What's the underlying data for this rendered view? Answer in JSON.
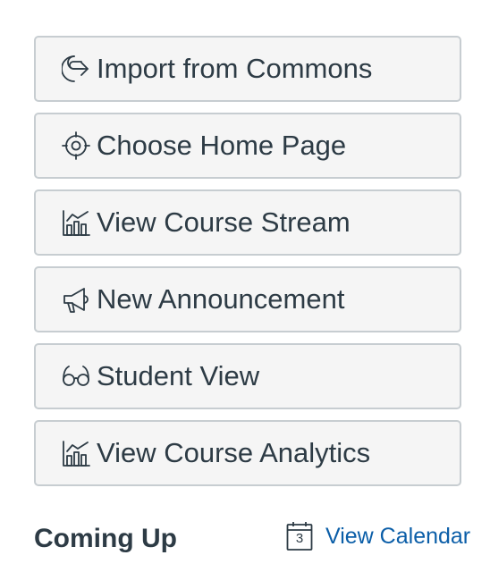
{
  "sidebar": {
    "buttons": [
      {
        "label": "Import from Commons",
        "icon": "commons-icon"
      },
      {
        "label": "Choose Home Page",
        "icon": "target-icon"
      },
      {
        "label": "View Course Stream",
        "icon": "analytics-icon"
      },
      {
        "label": "New Announcement",
        "icon": "announcement-icon"
      },
      {
        "label": "Student View",
        "icon": "glasses-icon"
      },
      {
        "label": "View Course Analytics",
        "icon": "analytics-icon"
      }
    ],
    "coming_up": {
      "heading": "Coming Up",
      "calendar_link": "View Calendar",
      "calendar_day": "3"
    }
  },
  "colors": {
    "text": "#2d3b45",
    "link": "#0b5ea8",
    "button_bg": "#f5f5f5",
    "button_border": "#c7cdd1"
  }
}
